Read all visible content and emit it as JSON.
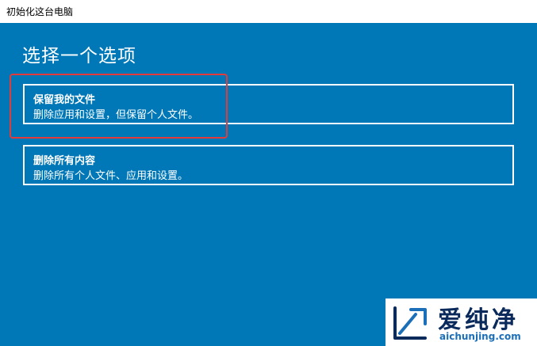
{
  "window": {
    "title": "初始化这台电脑"
  },
  "page": {
    "heading": "选择一个选项"
  },
  "options": [
    {
      "title": "保留我的文件",
      "description": "删除应用和设置，但保留个人文件。"
    },
    {
      "title": "删除所有内容",
      "description": "删除所有个人文件、应用和设置。"
    }
  ],
  "watermark": {
    "brand": "爱纯净",
    "url": "aichunjing.com"
  },
  "colors": {
    "background": "#0078b7",
    "highlight": "#e43a3a",
    "text": "#ffffff"
  }
}
